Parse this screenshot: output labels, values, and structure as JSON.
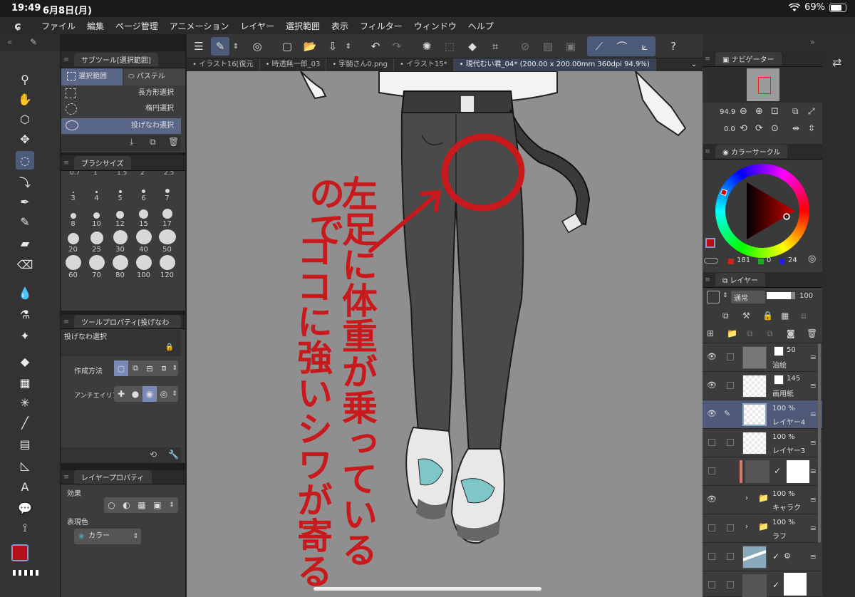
{
  "status": {
    "time": "19:49",
    "date": "6月8日(月)",
    "battery": "69%",
    "battery_level": 0.69
  },
  "menu": [
    "ファイル",
    "編集",
    "ページ管理",
    "アニメーション",
    "レイヤー",
    "選択範囲",
    "表示",
    "フィルター",
    "ウィンドウ",
    "ヘルプ"
  ],
  "subtool": {
    "title": "サブツール[選択範囲]",
    "tab1": "選択範囲",
    "tab2": "パステル",
    "items": [
      "長方形選択",
      "楕円選択",
      "投げなわ選択"
    ]
  },
  "brush_size": {
    "title": "ブラシサイズ",
    "top_row": [
      "0.7",
      "1",
      "1.5",
      "2",
      "2.5"
    ],
    "sizes": [
      "3",
      "4",
      "5",
      "6",
      "7",
      "8",
      "10",
      "12",
      "15",
      "17",
      "20",
      "25",
      "30",
      "40",
      "50",
      "60",
      "70",
      "80",
      "100",
      "120"
    ]
  },
  "tool_property": {
    "title": "ツールプロパティ[投げなわ",
    "tool_name": "投げなわ選択",
    "mode_label": "作成方法",
    "aa_label": "アンチエイリア"
  },
  "layer_property": {
    "title": "レイヤープロパティ",
    "effect_label": "効果",
    "color_label": "表現色",
    "color_value": "カラー"
  },
  "doc_tabs": [
    "イラスト16[復元",
    "時透無一郎_03",
    "宇髄さん0.png",
    "イラスト15*",
    "現代むい君_04* (200.00 x 200.00mm 360dpi 94.9%)"
  ],
  "annotation_lines": [
    "左足に体重が乗っているので",
    "ココに強いシワが寄る"
  ],
  "navigator": {
    "title": "ナビゲーター",
    "zoom": "94.9",
    "angle": "0.0"
  },
  "color_circle": {
    "title": "カラーサークル",
    "r": "181",
    "g": "0",
    "b": "24",
    "main_color": "#b51018"
  },
  "layers": {
    "title": "レイヤー",
    "blend": "通常",
    "opacity": "100",
    "rows": [
      {
        "pct": "50",
        "name": "油絵"
      },
      {
        "pct": "145",
        "name": "画用紙"
      },
      {
        "pct": "100 %",
        "name": "レイヤー4"
      },
      {
        "pct": "100 %",
        "name": "レイヤー3"
      },
      {
        "pct": "",
        "name": ""
      },
      {
        "pct": "100 %",
        "name": "キャラク"
      },
      {
        "pct": "100 %",
        "name": "ラフ"
      },
      {
        "pct": "",
        "name": ""
      },
      {
        "pct": "",
        "name": ""
      }
    ]
  },
  "colors": {
    "accent": "#b51018",
    "selected_bg": "#5a6688",
    "canvas_bg": "#8f8f8f"
  }
}
